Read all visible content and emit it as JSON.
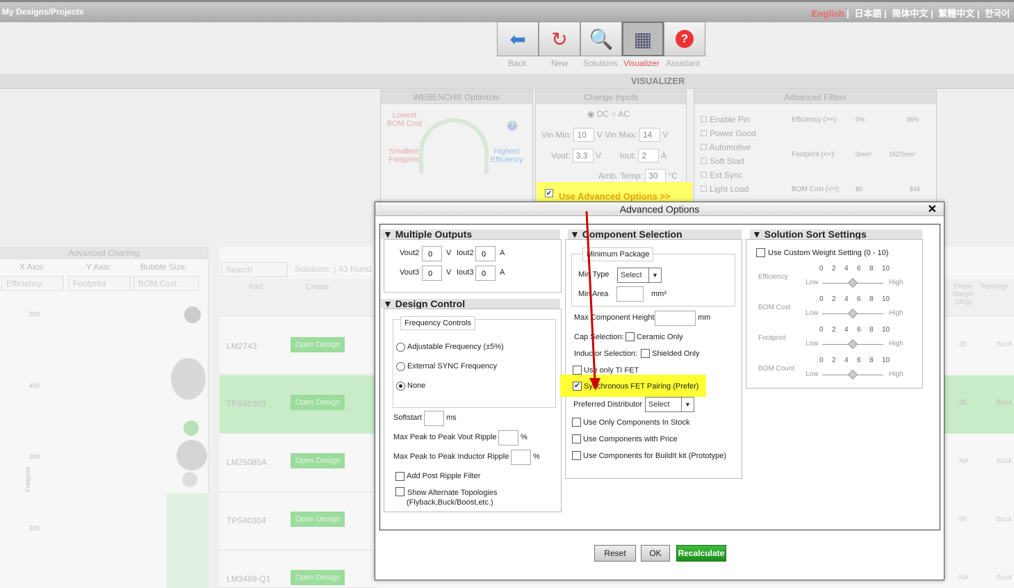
{
  "app": {
    "title": "My Designs/Projects"
  },
  "languages": [
    "English",
    "日本語",
    "简体中文",
    "繁體中文",
    "한국어"
  ],
  "toolbar": {
    "back": "Back",
    "new": "New",
    "solutions": "Solutions",
    "visualizer": "Visualizer",
    "assistant": "Assistant",
    "section_title": "VISUALIZER"
  },
  "bg_panels": {
    "optimizer": {
      "title": "WEBENCH® Optimizer",
      "lowest_bom": "Lowest BOM Cost",
      "smallest_footprint": "Smallest Footprint",
      "highest_eff": "Highest Efficiency"
    },
    "change_inputs": {
      "title": "Change Inputs",
      "dc": "DC",
      "ac": "AC",
      "vin_min_label": "Vin Min:",
      "vin_min": "10",
      "vin_max_label": "Vin Max:",
      "vin_max": "14",
      "vout_label": "Vout:",
      "vout": "3.3",
      "iout_label": "Iout:",
      "iout": "2",
      "amb_label": "Amb. Temp:",
      "amb": "30",
      "v": "V",
      "a": "A",
      "c": "°C",
      "adv_link": "Use Advanced Options >>"
    },
    "filters": {
      "title": "Advanced Filters",
      "items": [
        "Enable Pin",
        "Power Good",
        "Automotive",
        "Soft Start",
        "Ext Sync",
        "Light Load"
      ],
      "eff_label": "Efficiency (>=):",
      "eff_min": "0%",
      "eff_max": "95%",
      "fp_label": "Footprint (<=):",
      "fp_min": "0mm²",
      "fp_max": "1527mm²",
      "bom_label": "BOM Cost (<=):",
      "bom_min": "$0",
      "bom_max": "$49"
    },
    "charting": {
      "title": "Advanced Charting",
      "x_axis": "X Axis:",
      "y_axis": "Y Axis:",
      "bubble": "Bubble Size:",
      "x_val": "Efficiency",
      "y_val": "Footprint",
      "b_val": "BOM Cost",
      "ticks": [
        "500",
        "400",
        "300",
        "200"
      ],
      "ylabel": "Footprint"
    },
    "grid": {
      "search": "Search",
      "solutions": "Solutions: ( 43 found",
      "col_part": "Part",
      "col_create": "Create",
      "col_phase": "Phase Margin (deg)",
      "col_topo": "Topology",
      "open": "Open Design",
      "parts": [
        "LM2743",
        "TPS40303",
        "LM25085A",
        "TPS40304",
        "LM3489-Q1"
      ],
      "phase": [
        "38",
        "65",
        "NA",
        "66",
        "NA"
      ],
      "topo": [
        "Buck",
        "Buck",
        "Buck",
        "Buck",
        "Buck"
      ]
    }
  },
  "dialog": {
    "title": "Advanced Options",
    "close": "✕",
    "multiple_outputs": {
      "title": "Multiple Outputs",
      "vout2": "Vout2",
      "vout2_val": "0",
      "iout2": "Iout2",
      "iout2_val": "0",
      "vout3": "Vout3",
      "vout3_val": "0",
      "iout3": "Iout3",
      "iout3_val": "0",
      "v": "V",
      "a": "A"
    },
    "design_control": {
      "title": "Design Control",
      "freq_controls": "Frequency Controls",
      "adj_freq": "Adjustable Frequency (±5%)",
      "ext_sync": "External SYNC Frequency",
      "none": "None",
      "softstart": "Softstart",
      "ms": "ms",
      "vout_ripple": "Max Peak to Peak Vout Ripple",
      "ind_ripple": "Max Peak to Peak Inductor Ripple",
      "pct": "%",
      "post_ripple": "Add Post Ripple Filter",
      "alt_topo": "Show Alternate Topologies",
      "alt_topo2": "(Flyback,Buck/Boost,etc.)"
    },
    "component_selection": {
      "title": "Component Selection",
      "min_package": "Minimum Package",
      "min_type": "Min Type",
      "min_type_val": "Select",
      "min_area": "Min Area",
      "mm2": "mm²",
      "max_height": "Max Component Height",
      "mm": "mm",
      "cap_sel": "Cap Selection:",
      "ceramic": "Ceramic Only",
      "ind_sel": "Inductor Selection:",
      "shielded": "Shielded Only",
      "ti_fet": "Use only TI FET",
      "sync_fet": "Synchronous FET Pairing (Prefer)",
      "pref_dist": "Preferred Distributor",
      "pref_dist_val": "Select",
      "in_stock": "Use Only Components In Stock",
      "with_price": "Use Components with Price",
      "buildit": "Use Components for BuildIt kit (Prototype)"
    },
    "sort_settings": {
      "title": "Solution Sort Settings",
      "custom_weight": "Use Custom Weight Setting (0 - 10)",
      "scale": [
        "0",
        "2",
        "4",
        "6",
        "8",
        "10"
      ],
      "low": "Low",
      "high": "High",
      "items": [
        "Efficiency",
        "BOM Cost",
        "Footprint",
        "BOM Count"
      ],
      "knob_value": 5
    },
    "buttons": {
      "reset": "Reset",
      "ok": "OK",
      "recalc": "Recalculate"
    }
  }
}
